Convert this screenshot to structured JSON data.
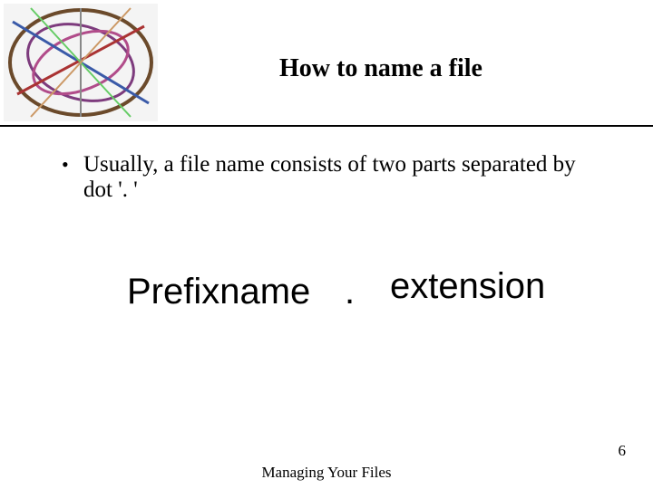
{
  "title": "How to name a file",
  "bullet": "Usually, a file name consists of two parts separated by dot '. '",
  "pieces": {
    "prefix": "Prefixname",
    "dot": ".",
    "extension": "extension"
  },
  "footer": "Managing Your Files",
  "page_number": "6"
}
